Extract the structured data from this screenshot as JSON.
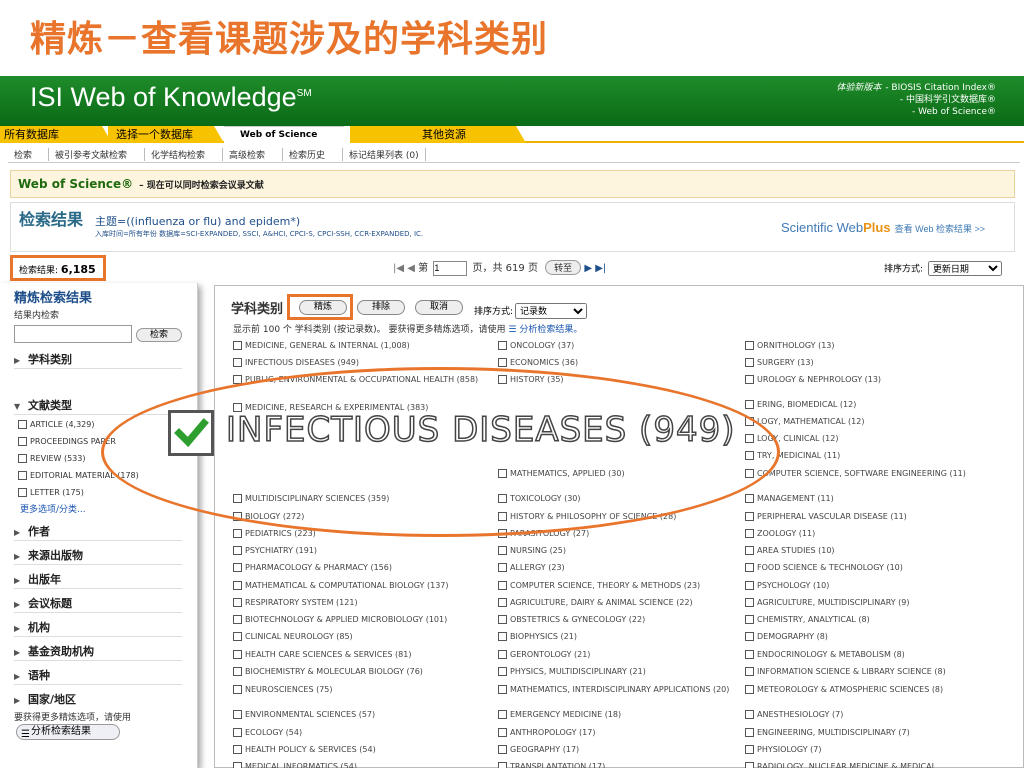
{
  "slide_title": "精炼－查看课题涉及的学科类别",
  "header": {
    "logo": "ISI Web of Knowledge",
    "logo_sup": "SM",
    "edition_label": "体验新版本",
    "edition_lines": [
      "- BIOSIS Citation Index®",
      "- 中国科学引文数据库®",
      "- Web of Science®"
    ]
  },
  "tabs": [
    "所有数据库",
    "选择一个数据库",
    "Web of Science",
    "其他资源"
  ],
  "subnav": [
    "检索",
    "被引参考文献检索",
    "化学结构检索",
    "高级检索",
    "检索历史",
    "标记结果列表 (0)"
  ],
  "wos": {
    "title": "Web of Science®",
    "subtitle": "– 现在可以同时检索会议录文献"
  },
  "results": {
    "title": "检索结果",
    "query": "主题=((influenza or flu) and epidem*)",
    "dbline": "入库时间=所有年份 数据库=SCI-EXPANDED, SSCI, A&HCI, CPCI-S, CPCI-SSH, CCR-EXPANDED, IC.",
    "webplus_a": "Scientific Web",
    "webplus_b": "Plus",
    "webplus_link": "查看 Web 检索结果 >>",
    "count_label": "检索结果:",
    "count": "6,185"
  },
  "pager": {
    "page_label": "第",
    "page_value": "1",
    "of_text": "页，共 619 页",
    "goto": "转至"
  },
  "sort": {
    "label": "排序方式:",
    "value": "更新日期"
  },
  "sidebar": {
    "title": "精炼检索结果",
    "subtitle": "结果内检索",
    "search_btn": "检索",
    "sections": [
      "学科类别",
      "文献类型",
      "作者",
      "来源出版物",
      "出版年",
      "会议标题",
      "机构",
      "基金资助机构",
      "语种",
      "国家/地区"
    ],
    "doc_types": [
      "ARTICLE (4,329)",
      "PROCEEDINGS PAPER",
      "REVIEW (533)",
      "EDITORIAL MATERIAL (178)",
      "LETTER (175)"
    ],
    "more": "更多选项/分类...",
    "analyze_text": "要获得更多精炼选项，请使用",
    "analyze_btn": "分析检索结果"
  },
  "panel": {
    "title": "学科类别",
    "refine": "精炼",
    "exclude": "排除",
    "cancel": "取消",
    "sort_label": "排序方式:",
    "sort_value": "记录数",
    "showtop": "显示前 100 个 学科类别 (按记录数)。 要获得更多精炼选项，请使用",
    "analyze_link": "分析检索结果。"
  },
  "categories": {
    "col1": [
      "MEDICINE, GENERAL & INTERNAL (1,008)",
      "INFECTIOUS DISEASES (949)",
      "PUBLIC, ENVIRONMENTAL & OCCUPATIONAL HEALTH (858)",
      "MEDICINE, RESEARCH & EXPERIMENTAL (383)",
      "MULTIDISCIPLINARY SCIENCES (359)",
      "BIOLOGY (272)",
      "PEDIATRICS (223)",
      "PSYCHIATRY (191)",
      "PHARMACOLOGY & PHARMACY (156)",
      "MATHEMATICAL & COMPUTATIONAL BIOLOGY (137)",
      "RESPIRATORY SYSTEM (121)",
      "BIOTECHNOLOGY & APPLIED MICROBIOLOGY (101)",
      "CLINICAL NEUROLOGY (85)",
      "HEALTH CARE SCIENCES & SERVICES (81)",
      "BIOCHEMISTRY & MOLECULAR BIOLOGY (76)",
      "NEUROSCIENCES (75)",
      "ENVIRONMENTAL SCIENCES (57)",
      "ECOLOGY (54)",
      "HEALTH POLICY & SERVICES (54)",
      "MEDICAL INFORMATICS (54)"
    ],
    "col2": [
      "ONCOLOGY (37)",
      "ECONOMICS (36)",
      "HISTORY (35)",
      "MATHEMATICS, APPLIED (30)",
      "TOXICOLOGY (30)",
      "HISTORY & PHILOSOPHY OF SCIENCE (28)",
      "PARASITOLOGY (27)",
      "NURSING (25)",
      "ALLERGY (23)",
      "COMPUTER SCIENCE, THEORY & METHODS (23)",
      "AGRICULTURE, DAIRY & ANIMAL SCIENCE (22)",
      "OBSTETRICS & GYNECOLOGY (22)",
      "BIOPHYSICS (21)",
      "GERONTOLOGY (21)",
      "PHYSICS, MULTIDISCIPLINARY (21)",
      "MATHEMATICS, INTERDISCIPLINARY APPLICATIONS (20)",
      "EMERGENCY MEDICINE (18)",
      "ANTHROPOLOGY (17)",
      "GEOGRAPHY (17)",
      "TRANSPLANTATION (17)"
    ],
    "col3": [
      "ORNITHOLOGY (13)",
      "SURGERY (13)",
      "UROLOGY & NEPHROLOGY (13)",
      "ERING, BIOMEDICAL (12)",
      "LOGY, MATHEMATICAL (12)",
      "LOGY, CLINICAL (12)",
      "TRY, MEDICINAL (11)",
      "COMPUTER SCIENCE, SOFTWARE ENGINEERING (11)",
      "MANAGEMENT (11)",
      "PERIPHERAL VASCULAR DISEASE (11)",
      "ZOOLOGY (11)",
      "AREA STUDIES (10)",
      "FOOD SCIENCE & TECHNOLOGY (10)",
      "PSYCHOLOGY (10)",
      "AGRICULTURE, MULTIDISCIPLINARY (9)",
      "CHEMISTRY, ANALYTICAL (8)",
      "DEMOGRAPHY (8)",
      "ENDOCRINOLOGY & METABOLISM (8)",
      "INFORMATION SCIENCE & LIBRARY SCIENCE (8)",
      "METEOROLOGY & ATMOSPHERIC SCIENCES (8)",
      "ANESTHESIOLOGY (7)",
      "ENGINEERING, MULTIDISCIPLINARY (7)",
      "PHYSIOLOGY (7)",
      "RADIOLOGY, NUCLEAR MEDICINE & MEDICAL"
    ]
  },
  "zoom_label": "INFECTIOUS DISEASES (949)",
  "colors": {
    "accent": "#e8752b",
    "header_green": "#0b6a16",
    "tab_yellow": "#f7c300"
  }
}
